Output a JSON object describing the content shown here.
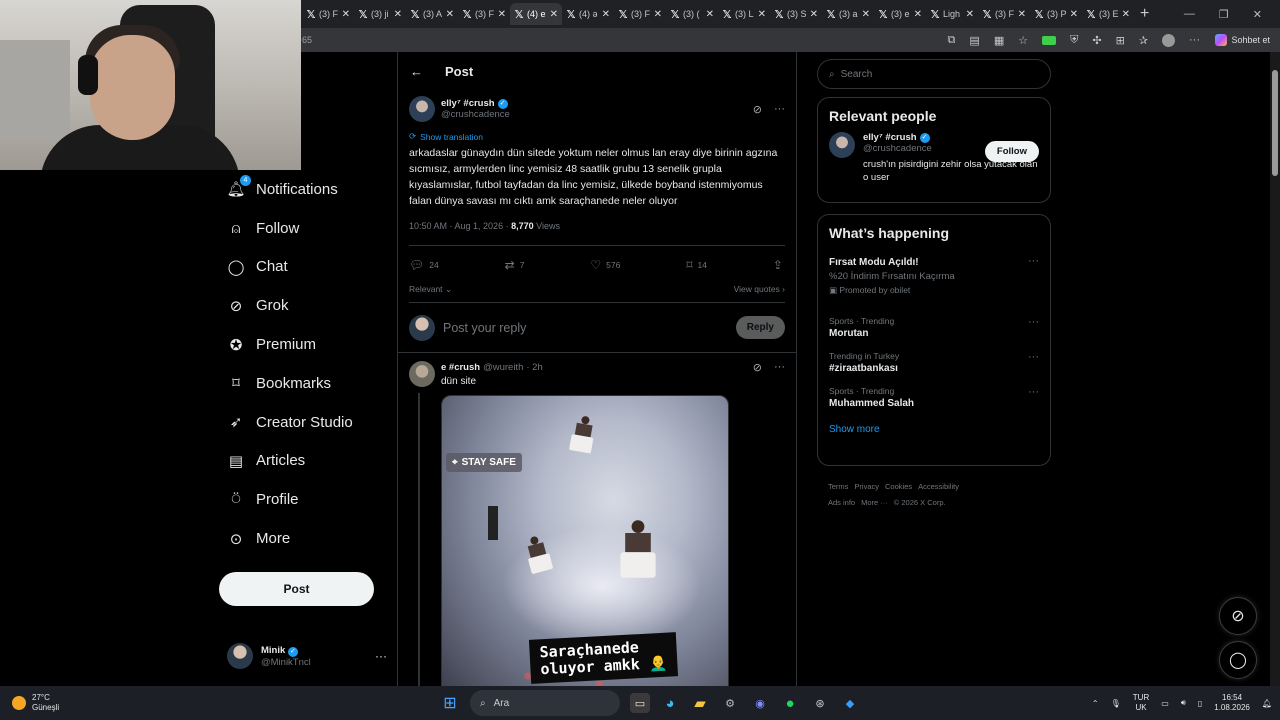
{
  "browser": {
    "tabs": [
      {
        "label": "(3) F",
        "active": false
      },
      {
        "label": "(3) ji",
        "active": false
      },
      {
        "label": "(3) A",
        "active": false
      },
      {
        "label": "(3) F",
        "active": false
      },
      {
        "label": "(4) e",
        "active": true
      },
      {
        "label": "(4) ə",
        "active": false
      },
      {
        "label": "(3) F",
        "active": false
      },
      {
        "label": "(3) ( ",
        "active": false
      },
      {
        "label": "(3) L",
        "active": false
      },
      {
        "label": "(3) S",
        "active": false
      },
      {
        "label": "(3) a",
        "active": false
      },
      {
        "label": "(3) e",
        "active": false
      },
      {
        "label": "Ligh",
        "active": false
      },
      {
        "label": "(3) F",
        "active": false
      },
      {
        "label": "(3) P",
        "active": false
      },
      {
        "label": "(3) E",
        "active": false
      }
    ],
    "url": "65",
    "copilot_label": "Sohbet et"
  },
  "nav": {
    "items": [
      {
        "label": "Notifications",
        "icon": "bell-icon",
        "badge": "4"
      },
      {
        "label": "Follow",
        "icon": "person-plus-icon"
      },
      {
        "label": "Chat",
        "icon": "chat-icon"
      },
      {
        "label": "Grok",
        "icon": "grok-icon"
      },
      {
        "label": "Premium",
        "icon": "premium-icon"
      },
      {
        "label": "Bookmarks",
        "icon": "bookmark-icon"
      },
      {
        "label": "Creator Studio",
        "icon": "rocket-icon"
      },
      {
        "label": "Articles",
        "icon": "articles-icon"
      },
      {
        "label": "Profile",
        "icon": "person-icon"
      },
      {
        "label": "More",
        "icon": "more-circle-icon"
      }
    ],
    "post_button": "Post",
    "account": {
      "name": "Minik",
      "handle": "@MinikTncl"
    }
  },
  "main": {
    "header_title": "Post",
    "post": {
      "display_name": "elly⁷ #crush",
      "handle": "@crushcadence",
      "translate": "Show translation",
      "text": "arkadaslar günaydın dün sitede yoktum neler olmus lan eray diye birinin agzına sıcmısız, armylerden linc yemisiz 48 saatlik grubu 13 senelik grupla kıyaslamıslar, futbol tayfadan da linc yemisiz, ülkede boyband istenmiyomus falan dünya savası mı cıktı amk saraçhanede neler oluyor",
      "time": "10:50 AM · Aug 1, 2026 · ",
      "views": "8,770",
      "views_label": " Views",
      "replies": "24",
      "reposts": "7",
      "likes": "576",
      "bookmarks": "14",
      "sort": "Relevant",
      "view_quotes": "View quotes"
    },
    "reply_box": {
      "placeholder": "Post your reply",
      "button": "Reply"
    },
    "reply": {
      "display_name": "e #crush",
      "handle": "@wureith",
      "time": "· 2h",
      "text": "dün site",
      "media_badge": "STAY SAFE",
      "media_caption_1": "Saraçhanede",
      "media_caption_2": "oluyor amkk 👨‍🦲"
    }
  },
  "right": {
    "search_placeholder": "Search",
    "relevant_title": "Relevant people",
    "person": {
      "display_name": "elly⁷ #crush",
      "handle": "@crushcadence",
      "bio": "crush'ın pisirdigini zehir olsa yutacak olan o user",
      "follow": "Follow"
    },
    "happening_title": "What’s happening",
    "trends": [
      {
        "context": "",
        "name": "Fırsat Modu Açıldı!",
        "sub": "%20 İndirim Fırsatını Kaçırma",
        "promo": "Promoted by obilet"
      },
      {
        "context": "Sports · Trending",
        "name": "Morutan"
      },
      {
        "context": "Trending in Turkey",
        "name": "#ziraatbankası"
      },
      {
        "context": "Sports · Trending",
        "name": "Muhammed Salah"
      }
    ],
    "show_more": "Show more",
    "footer": [
      "Terms",
      "Privacy",
      "Cookies",
      "Accessibility",
      "Ads info",
      "More ···",
      "© 2026 X Corp."
    ]
  },
  "taskbar": {
    "temp": "27°C",
    "weather": "Güneşli",
    "search": "Ara",
    "lang1": "TUR",
    "lang2": "UK",
    "time": "16:54",
    "date": "1.08.2026"
  }
}
